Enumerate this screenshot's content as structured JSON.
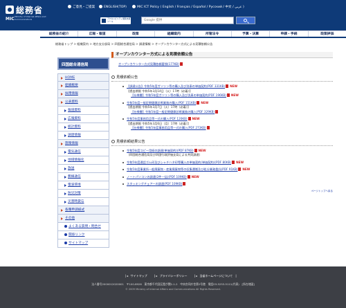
{
  "header": {
    "logo_kanji": "総務省",
    "logo_mic": "MIC",
    "logo_en": "Ministry of Internal Affairs and Communications",
    "lang_ja": "ご意見・ご提案",
    "lang_en": "ENGLISH(TOP)",
    "lang_multi": "MIC ICT Policy ( English / Français / Español / Русский / 中文 / عربي )",
    "access_label": "アクセシビリティ閲覧支援ツール",
    "search_placeholder": "Google 提供"
  },
  "gnav": [
    "総務省の紹介",
    "広報・報道",
    "政策",
    "組織案内",
    "所管法令",
    "予算・決算",
    "申請・手続",
    "政策評価"
  ],
  "breadcrumb": "総務省トップ > 組織案内 > 地方支分部局 > 四国総合通信局 > 調達情報 > オープンカウンター方式による見積依頼公告",
  "sidebar": {
    "title": "四国総合通信局",
    "items": [
      {
        "label": "HOME",
        "kind": "first"
      },
      {
        "label": "組織概要",
        "kind": "top"
      },
      {
        "label": "採用情報",
        "kind": "top"
      },
      {
        "label": "公表資料",
        "kind": "top"
      },
      {
        "label": "報道資料",
        "kind": "sub"
      },
      {
        "label": "広報資料",
        "kind": "sub"
      },
      {
        "label": "統計資料",
        "kind": "sub"
      },
      {
        "label": "調達情報",
        "kind": "sub"
      },
      {
        "label": "施策情報",
        "kind": "top"
      },
      {
        "label": "電気通信",
        "kind": "sub"
      },
      {
        "label": "地域情報化",
        "kind": "sub"
      },
      {
        "label": "放送",
        "kind": "sub"
      },
      {
        "label": "無線通信",
        "kind": "sub"
      },
      {
        "label": "電波環境",
        "kind": "sub"
      },
      {
        "label": "防災対策",
        "kind": "sub"
      },
      {
        "label": "災害時貸与",
        "kind": "sub"
      },
      {
        "label": "各種申請様式",
        "kind": "top"
      },
      {
        "label": "その他",
        "kind": "top"
      },
      {
        "label": "よくある質問・問合せ",
        "kind": "link"
      },
      {
        "label": "関係リンク",
        "kind": "link"
      },
      {
        "label": "サイトマップ",
        "kind": "link"
      }
    ]
  },
  "main": {
    "title": "オープンカウンター方式による見積依頼公告",
    "top_link": "オープンカウンター方式見積依頼要領(177KB)",
    "section1": "見積依頼公告",
    "s1_entries": [
      {
        "text": "【調達公告】令和5年度ガソリン等の購入及び洗車の単価契約(PDF 331KB)",
        "extra": "NEW",
        "cont": false
      },
      {
        "text": "【提出期限 令和5年3月14日（火）17時（必着）】",
        "extra": "",
        "cont": true
      },
      {
        "text": "【仕様書】令和5年度ガソリン等の購入及び洗車の単価契約(PDF 196KB)",
        "extra": "NEW",
        "cont": true,
        "sub": true
      },
      {
        "text": "令和5年度一般定期健康診断業務の購入(PDF 151KB)",
        "extra": "NEW",
        "cont": false
      },
      {
        "text": "【提出期限 令和5年3月7日（火）17時（必着）】",
        "extra": "",
        "cont": true
      },
      {
        "text": "【仕様書】令和5年度一般定期健康診断業務の購入(PDF 329KB)",
        "extra": "",
        "cont": true,
        "sub": true
      },
      {
        "text": "令和5年度事務用品等一式の購入(PDF 120KB)",
        "extra": "NEW",
        "cont": false
      },
      {
        "text": "【提出期限 令和5年3月6日（月）17時（必着）】",
        "extra": "",
        "cont": true
      },
      {
        "text": "【仕様書】令和5年度事務用品等一式の購入(PDF 273KB)",
        "extra": "",
        "cont": true,
        "sub": true
      }
    ],
    "section2": "見積依頼結果公告",
    "s2_entries": [
      {
        "text": "令和5年度コピー用紙の調達(単価契約)(PDF 87KB)",
        "extra": "NEW"
      },
      {
        "text": "（四国総合通信局及び四国行政評価支局による共同調達）",
        "extra": "",
        "cont": true
      },
      {
        "text": "令和5年度通話ゴム印及びシャチハタ印等購入の単価契約(単価契約)(PDF 80KB)",
        "extra": "NEW"
      },
      {
        "text": "令和5年度事業所一般廃棄物・産業廃棄物等の収集運搬及び処分業務委託(PDF 91KB)",
        "extra": "NEW"
      },
      {
        "text": "ノートパソコンの調達(2件一括)(PDF 109KB)",
        "extra": "NEW"
      },
      {
        "text": "スタッキングチェアーの調達(PDF 109KB)",
        "extra": ""
      }
    ],
    "page_top": "ページトップへ戻る"
  },
  "footer": {
    "links": [
      "サイトマップ",
      "プライバシーポリシー",
      "当省ホームページについて"
    ],
    "address": "法人番号2000012020001　〒100-8926　東京都千代田区霞が関2-1-2　中央合同庁舎第2号館　電話03-5253-5111(代表)　[所在地図]",
    "copyright": "© 2009 Ministry of Internal Affairs and Communications All Rights Reserved."
  }
}
